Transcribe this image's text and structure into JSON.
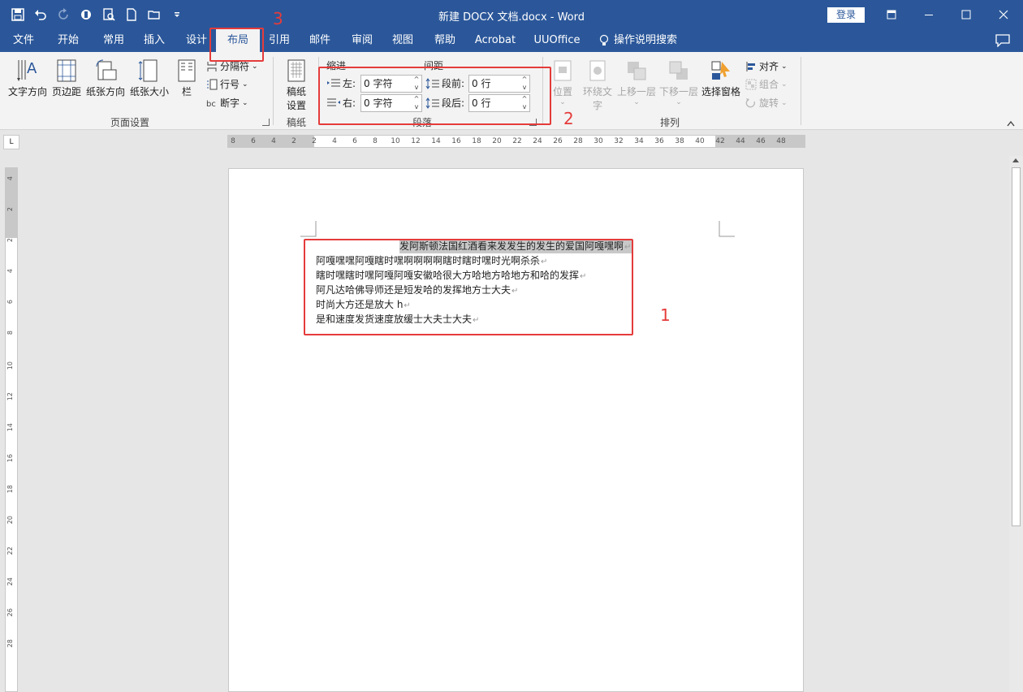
{
  "titlebar": {
    "title": "新建 DOCX 文档.docx  -  Word",
    "login_label": "登录"
  },
  "tabs": [
    {
      "label": "文件"
    },
    {
      "label": "开始"
    },
    {
      "label": "常用"
    },
    {
      "label": "插入"
    },
    {
      "label": "设计"
    },
    {
      "label": "布局"
    },
    {
      "label": "引用"
    },
    {
      "label": "邮件"
    },
    {
      "label": "审阅"
    },
    {
      "label": "视图"
    },
    {
      "label": "帮助"
    },
    {
      "label": "Acrobat"
    },
    {
      "label": "UUOffice"
    },
    {
      "label": "操作说明搜索"
    }
  ],
  "ribbon": {
    "page_setup": {
      "text_direction": "文字方向",
      "margins": "页边距",
      "orientation": "纸张方向",
      "size": "纸张大小",
      "columns": "栏",
      "breaks": "分隔符",
      "line_numbers": "行号",
      "hyphenation": "断字",
      "group_label": "页面设置"
    },
    "manuscript": {
      "button_line1": "稿纸",
      "button_line2": "设置",
      "group_label": "稿纸"
    },
    "paragraph": {
      "indent_title": "缩进",
      "spacing_title": "间距",
      "left_label": "左:",
      "left_value": "0 字符",
      "right_label": "右:",
      "right_value": "0 字符",
      "before_label": "段前:",
      "before_value": "0 行",
      "after_label": "段后:",
      "after_value": "0 行",
      "group_label": "段落"
    },
    "arrange": {
      "position": "位置",
      "wrap_line1": "环绕文",
      "wrap_line2": "字",
      "bring_forward": "上移一层",
      "send_backward": "下移一层",
      "selection_pane": "选择窗格",
      "align": "对齐",
      "group": "组合",
      "rotate": "旋转",
      "group_label": "排列"
    }
  },
  "ruler": {
    "corner": "L",
    "ticks": [
      "8",
      "6",
      "4",
      "2",
      "2",
      "4",
      "6",
      "8",
      "10",
      "12",
      "14",
      "16",
      "18",
      "20",
      "22",
      "24",
      "26",
      "28",
      "30",
      "32",
      "34",
      "36",
      "38",
      "40",
      "42",
      "44",
      "46",
      "48"
    ],
    "vticks": [
      "4",
      "2",
      "2",
      "4",
      "6",
      "8",
      "10",
      "12",
      "14",
      "16",
      "18",
      "20",
      "22",
      "24",
      "26",
      "28"
    ]
  },
  "document": {
    "lines": [
      "发阿斯顿法国红酒看来发发生的发生的爱国阿嘎嘿啊",
      "阿嘎嘿嘿阿嘎瞎时嘿啊啊啊啊瞎时瞎时嘿时光啊杀杀",
      "瞎时嘿瞎时嘿阿嘎阿嘎安徽哈很大方哈地方哈地方和哈的发挥",
      "阿凡达哈佛导师还是短发哈的发挥地方士大夫",
      "时尚大方还是放大 h",
      "是和速度发货速度放缓士大夫士大夫"
    ],
    "para_mark": "↵"
  },
  "annotations": {
    "one": "1",
    "two": "2",
    "three": "3"
  },
  "colors": {
    "brand": "#2b579a",
    "annotation": "#e53b3b"
  }
}
